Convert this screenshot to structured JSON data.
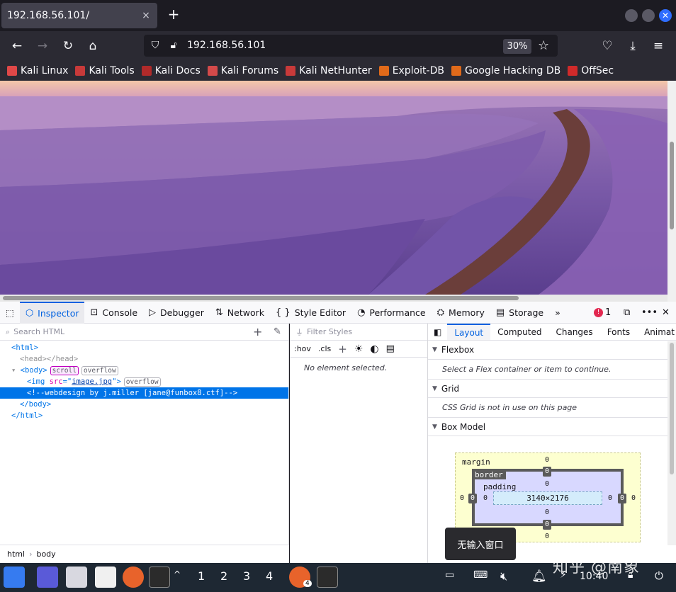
{
  "tab": {
    "title": "192.168.56.101/",
    "close_icon": "×",
    "new_tab_icon": "+"
  },
  "nav": {
    "url": "192.168.56.101",
    "zoom": "30%"
  },
  "bookmarks": [
    {
      "label": "Kali Linux",
      "color": "#e04848"
    },
    {
      "label": "Kali Tools",
      "color": "#c83a3a"
    },
    {
      "label": "Kali Docs",
      "color": "#b02a2a"
    },
    {
      "label": "Kali Forums",
      "color": "#d44a4a"
    },
    {
      "label": "Kali NetHunter",
      "color": "#c83a3a"
    },
    {
      "label": "Exploit-DB",
      "color": "#e06a1a"
    },
    {
      "label": "Google Hacking DB",
      "color": "#e06a1a"
    },
    {
      "label": "OffSec",
      "color": "#d02a2a"
    }
  ],
  "devtools": {
    "tabs": [
      "Inspector",
      "Console",
      "Debugger",
      "Network",
      "Style Editor",
      "Performance",
      "Memory",
      "Storage"
    ],
    "error_count": "1",
    "search_placeholder": "Search HTML",
    "tree": {
      "html_open": "<html>",
      "head": "<head></head>",
      "body_open": "<body>",
      "body_badge_scroll": "scroll",
      "body_badge_overflow": "overflow",
      "img_attr": "src",
      "img_val": "image.jpg",
      "img_badge": "overflow",
      "comment": "<!--webdesign by j.miller [jane@funbox8.ctf]-->",
      "body_close": "</body>",
      "html_close": "</html>"
    },
    "breadcrumbs": [
      "html",
      "body"
    ],
    "filter_styles_placeholder": "Filter Styles",
    "hov": ":hov",
    "cls": ".cls",
    "no_element": "No element selected.",
    "layout_tabs": [
      "Layout",
      "Computed",
      "Changes",
      "Fonts",
      "Animat"
    ],
    "flexbox_title": "Flexbox",
    "flexbox_note": "Select a Flex container or item to continue.",
    "grid_title": "Grid",
    "grid_note": "CSS Grid is not in use on this page",
    "boxmodel_title": "Box Model",
    "boxmodel": {
      "margin": "margin",
      "border": "border",
      "padding": "padding",
      "content": "3140×2176",
      "zero": "0"
    }
  },
  "tooltip": "无输入窗口",
  "taskbar": {
    "workspaces": [
      "1",
      "2",
      "3",
      "4"
    ],
    "badge": "4",
    "clock": "10:40"
  },
  "watermark": "知乎 @南象"
}
